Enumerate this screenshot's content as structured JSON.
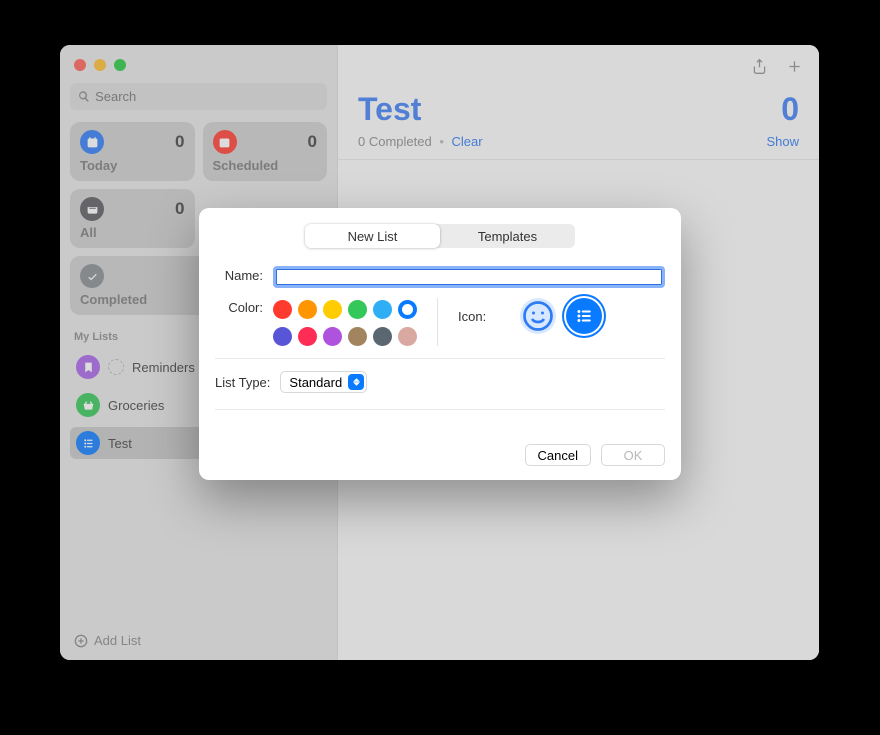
{
  "search": {
    "placeholder": "Search"
  },
  "cards": {
    "today": {
      "label": "Today",
      "count": "0"
    },
    "scheduled": {
      "label": "Scheduled",
      "count": "0"
    },
    "all": {
      "label": "All",
      "count": "0"
    },
    "completed": {
      "label": "Completed"
    }
  },
  "sidebar": {
    "section": "My Lists",
    "lists": [
      {
        "name": "Reminders",
        "color": "#a763e8"
      },
      {
        "name": "Groceries",
        "color": "#34c759"
      },
      {
        "name": "Test",
        "color": "#0a7aff"
      }
    ],
    "add_list": "Add List"
  },
  "main": {
    "title": "Test",
    "count": "0",
    "completed_text": "0 Completed",
    "dot": "•",
    "clear": "Clear",
    "show": "Show"
  },
  "modal": {
    "tabs": {
      "new_list": "New List",
      "templates": "Templates"
    },
    "name_label": "Name:",
    "name_value": "",
    "color_label": "Color:",
    "colors_row1": [
      "#ff3b30",
      "#ff9500",
      "#ffcc00",
      "#34c759",
      "#2faef5",
      "#0a7aff"
    ],
    "colors_row2": [
      "#5856d6",
      "#ff2d55",
      "#af52de",
      "#a2845e",
      "#5b6770",
      "#d9a8a0"
    ],
    "selected_color_index": 5,
    "icon_label": "Icon:",
    "list_type_label": "List Type:",
    "list_type_value": "Standard",
    "cancel": "Cancel",
    "ok": "OK"
  }
}
